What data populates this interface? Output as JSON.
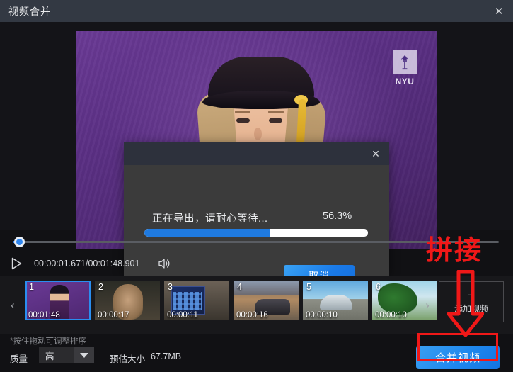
{
  "window": {
    "title": "视频合并",
    "close_icon": "close-icon"
  },
  "preview": {
    "watermark": {
      "text": "NYU",
      "icon": "nyu-torch-icon"
    }
  },
  "export_dialog": {
    "close_icon": "close-icon",
    "status_text": "正在导出，请耐心等待...",
    "percent_text": "56.3%",
    "progress_value": 56.3,
    "cancel_label": "取消",
    "accent_color": "#1f7ae0"
  },
  "transport": {
    "play_icon": "play-icon",
    "volume_icon": "volume-icon",
    "time_text": "00:00:01.671/00:01:48.901",
    "current_time": "00:00:01.671",
    "total_time": "00:01:48.901"
  },
  "strip": {
    "prev_icon": "chevron-left-icon",
    "next_icon": "chevron-right-icon",
    "thumbnails": [
      {
        "index": "1",
        "duration": "00:01:48",
        "selected": true
      },
      {
        "index": "2",
        "duration": "00:00:17",
        "selected": false
      },
      {
        "index": "3",
        "duration": "00:00:11",
        "selected": false
      },
      {
        "index": "4",
        "duration": "00:00:16",
        "selected": false
      },
      {
        "index": "5",
        "duration": "00:00:10",
        "selected": false
      },
      {
        "index": "6",
        "duration": "00:00:10",
        "selected": false
      }
    ],
    "add_video": {
      "plus_icon": "plus-icon",
      "label": "添加视频"
    }
  },
  "hint": "*按住拖动可调整排序",
  "bottom": {
    "quality_label": "质量",
    "quality_value": "高",
    "quality_arrow_icon": "chevron-down-icon",
    "estimate_label": "预估大小",
    "estimate_value": "67.7MB",
    "merge_label": "合并视频",
    "merge_color": "#1f87ed"
  },
  "annotations": {
    "text": "拼接",
    "color": "#f01818",
    "arrow_icon": "down-arrow-annotation",
    "highlight_box": "merge-button-highlight"
  }
}
